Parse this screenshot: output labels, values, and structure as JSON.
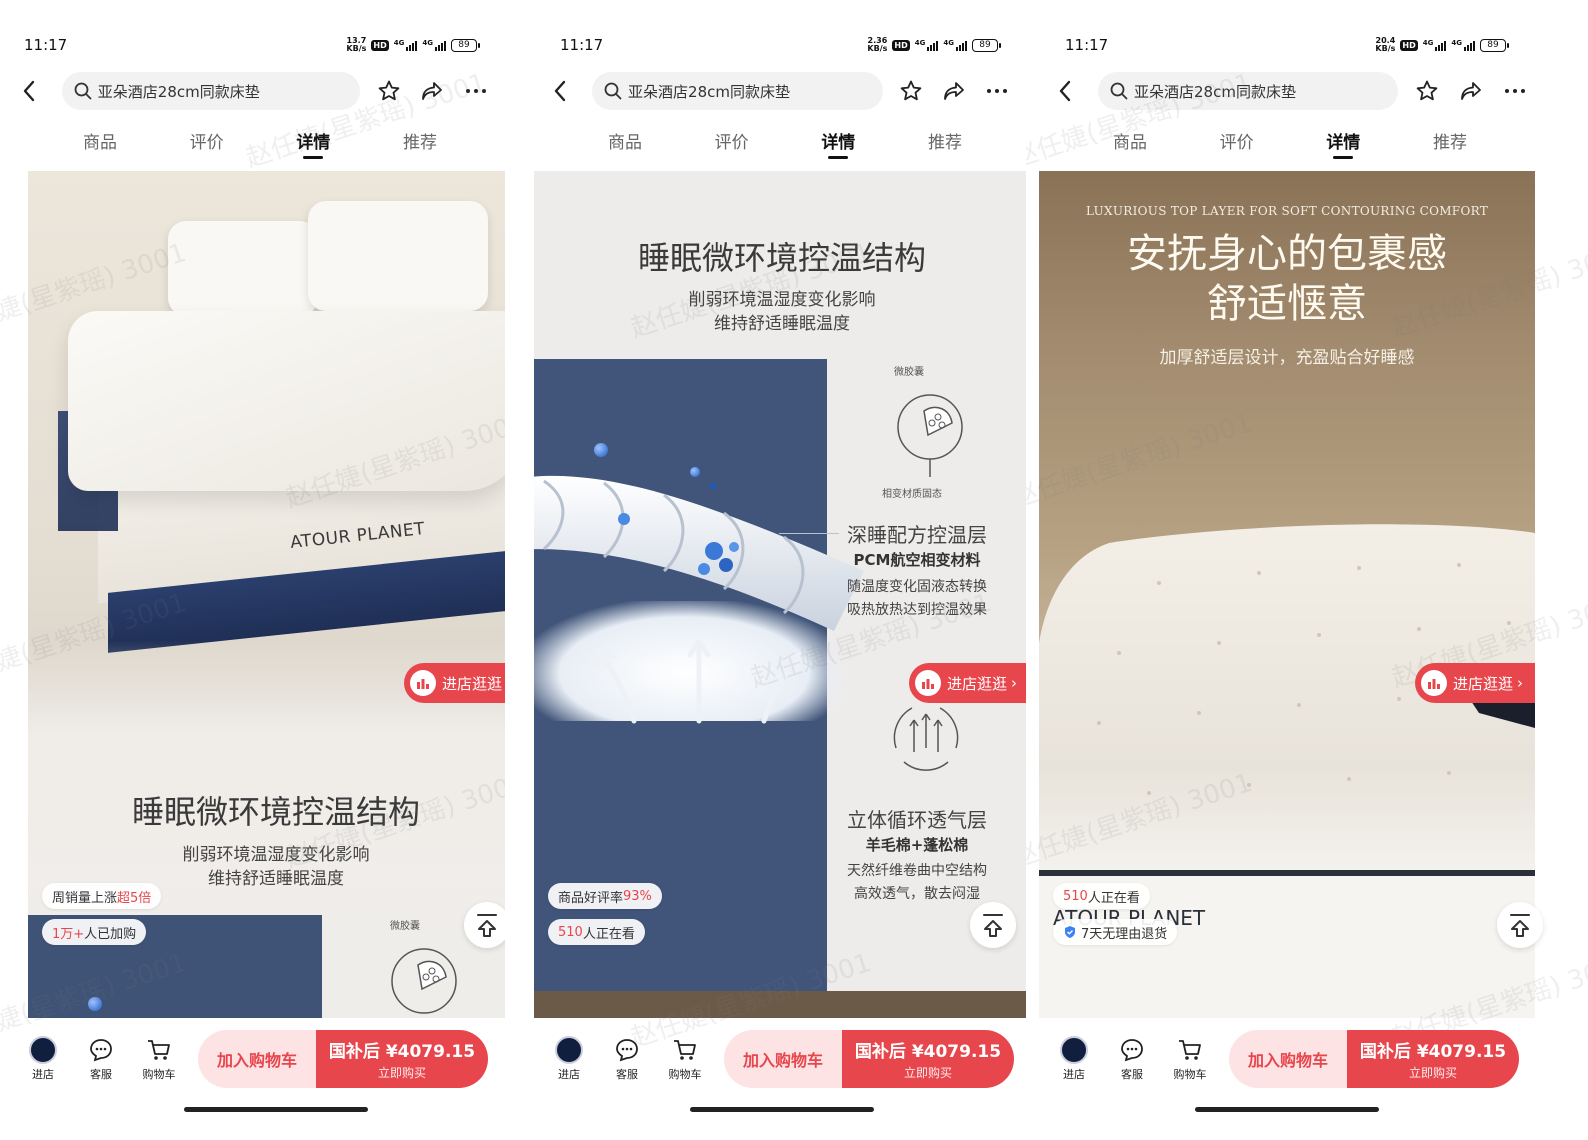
{
  "statusbar": {
    "time": "11:17",
    "speeds": [
      "13.7\nKB/s",
      "2.36\nKB/s",
      "20.4\nKB/s"
    ],
    "hd": "HD",
    "net": "4G",
    "battery": "89"
  },
  "search": {
    "query": "亚朵酒店28cm同款床垫"
  },
  "tabs": [
    "商品",
    "评价",
    "详情",
    "推荐"
  ],
  "active_tab": "详情",
  "panel1": {
    "brand": "ATOUR PLANET",
    "headline": "睡眠微环境控温结构",
    "sub1": "削弱环境温湿度变化影响",
    "sub2": "维持舒适睡眠温度",
    "badge_top_prefix": "周销量上涨",
    "badge_top_hl": "超5倍",
    "badge_bottom_hl": "1万+",
    "badge_bottom_suffix": "人已加购",
    "capsule_label": "微胶囊"
  },
  "panel2": {
    "headline": "睡眠微环境控温结构",
    "sub1": "削弱环境温湿度变化影响",
    "sub2": "维持舒适睡眠温度",
    "capsule_label": "微胶囊",
    "phase_label": "相变材质固态",
    "f1_title": "深睡配方控温层",
    "f1_sub": "PCM航空相变材料",
    "f1_d1": "随温度变化固液态转换",
    "f1_d2": "吸热放热达到控温效果",
    "f2_title": "立体循环透气层",
    "f2_sub": "羊毛棉+蓬松棉",
    "f2_d1": "天然纤维卷曲中空结构",
    "f2_d2": "高效透气，散去闷湿",
    "badge_top_prefix": "商品好评率",
    "badge_top_hl": "93%",
    "badge_bottom_hl": "510",
    "badge_bottom_suffix": "人正在看"
  },
  "panel3": {
    "eyebrow": "LUXURIOUS TOP LAYER FOR SOFT CONTOURING COMFORT",
    "head1": "安抚身心的包裹感",
    "head2": "舒适惬意",
    "sub": "加厚舒适层设计，充盈贴合好睡感",
    "brand_partial": "ATOUR PLANET",
    "badge_top_hl": "510",
    "badge_top_suffix": "人正在看",
    "badge_bottom": "7天无理由退货"
  },
  "shop_pill": "进店逛逛",
  "bottom": {
    "store": "进店",
    "service": "客服",
    "cart": "购物车",
    "add_cart": "加入购物车",
    "price": "国补后 ¥4079.15",
    "buy": "立即购买"
  },
  "watermark": "赵任婕(星紫瑶) 3001",
  "colors": {
    "accent": "#e8464d",
    "navy": "#41557a"
  }
}
